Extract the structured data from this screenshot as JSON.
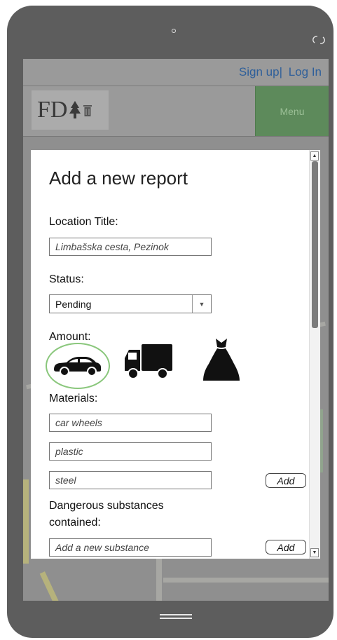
{
  "topbar": {
    "sign_up": "Sign up",
    "separator": "|",
    "log_in": "Log In"
  },
  "header": {
    "logo_text": "FD",
    "menu_label": "Menu"
  },
  "modal": {
    "title": "Add a new report",
    "location": {
      "label": "Location Title:",
      "value": "Limbašska cesta, Pezinok"
    },
    "status": {
      "label": "Status:",
      "selected": "Pending",
      "arrow": "▼"
    },
    "amount": {
      "label": "Amount:",
      "options": [
        {
          "icon": "car-icon",
          "selected": true
        },
        {
          "icon": "truck-icon",
          "selected": false
        },
        {
          "icon": "trash-bag-icon",
          "selected": false
        }
      ]
    },
    "materials": {
      "label": "Materials:",
      "items": [
        "car wheels",
        "plastic",
        "steel"
      ],
      "add_label": "Add"
    },
    "dangerous": {
      "label_line1": "Dangerous substances",
      "label_line2": "contained:",
      "placeholder": "Add a new substance",
      "add_label": "Add"
    }
  },
  "scrollbar": {
    "up": "▲",
    "down": "▼"
  },
  "colors": {
    "accent": "#5d8a5b",
    "link": "#2e5f9a",
    "selected_ring": "#8ac77c"
  }
}
